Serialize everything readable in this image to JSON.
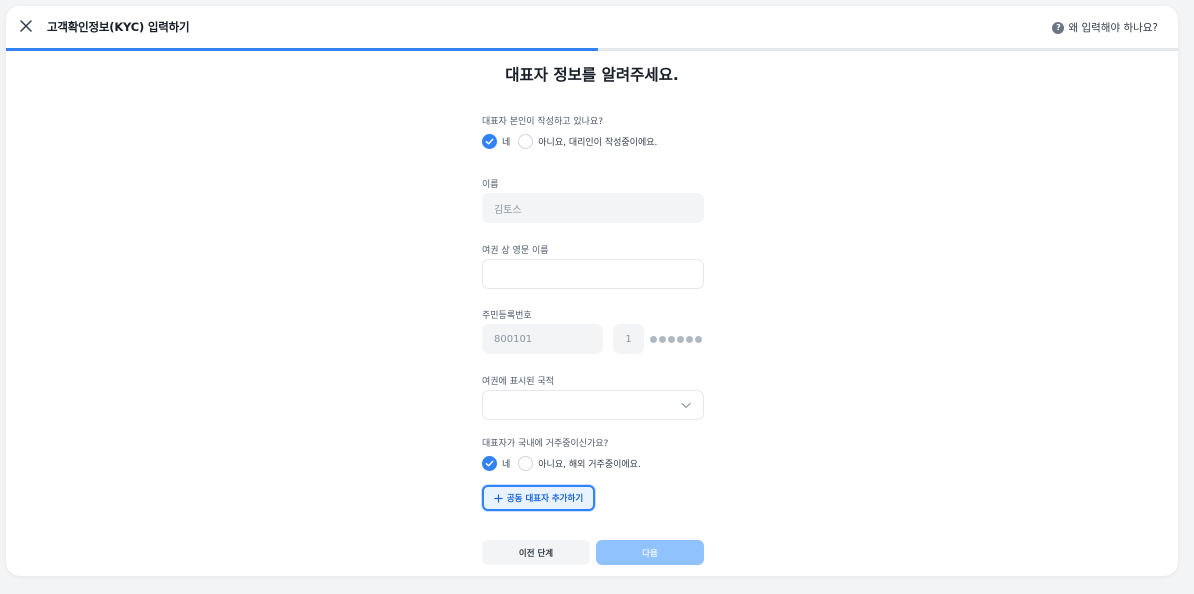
{
  "header": {
    "title": "고객확인정보(KYC) 입력하기",
    "help_label": "왜 입력해야 하나요?",
    "help_icon": "?"
  },
  "progress": {
    "value": 0.505
  },
  "colors": {
    "accent": "#3182f6",
    "accent_disabled": "#90c2ff",
    "field_bg": "#f2f4f6"
  },
  "page_title": "대표자 정보를 알려주세요.",
  "self_writing": {
    "question": "대표자 본인이 작성하고 있나요?",
    "options": [
      {
        "label": "네",
        "selected": true
      },
      {
        "label": "아니요, 대리인이 작성중이에요.",
        "selected": false
      }
    ]
  },
  "name": {
    "label": "이름",
    "value": "김토스"
  },
  "passport_name": {
    "label": "여권 상 영문 이름",
    "value": ""
  },
  "rrn": {
    "label": "주민등록번호",
    "front": "800101",
    "back_first": "1",
    "masked_count": 6
  },
  "nationality": {
    "label": "여권에 표시된 국적",
    "value": ""
  },
  "residence": {
    "question": "대표자가 국내에 거주중이신가요?",
    "options": [
      {
        "label": "네",
        "selected": true
      },
      {
        "label": "아니요, 해외 거주중이에요.",
        "selected": false
      }
    ]
  },
  "add_co_rep": {
    "label": "공동 대표자 추가하기"
  },
  "footer": {
    "prev_label": "이전 단계",
    "next_label": "다음"
  }
}
